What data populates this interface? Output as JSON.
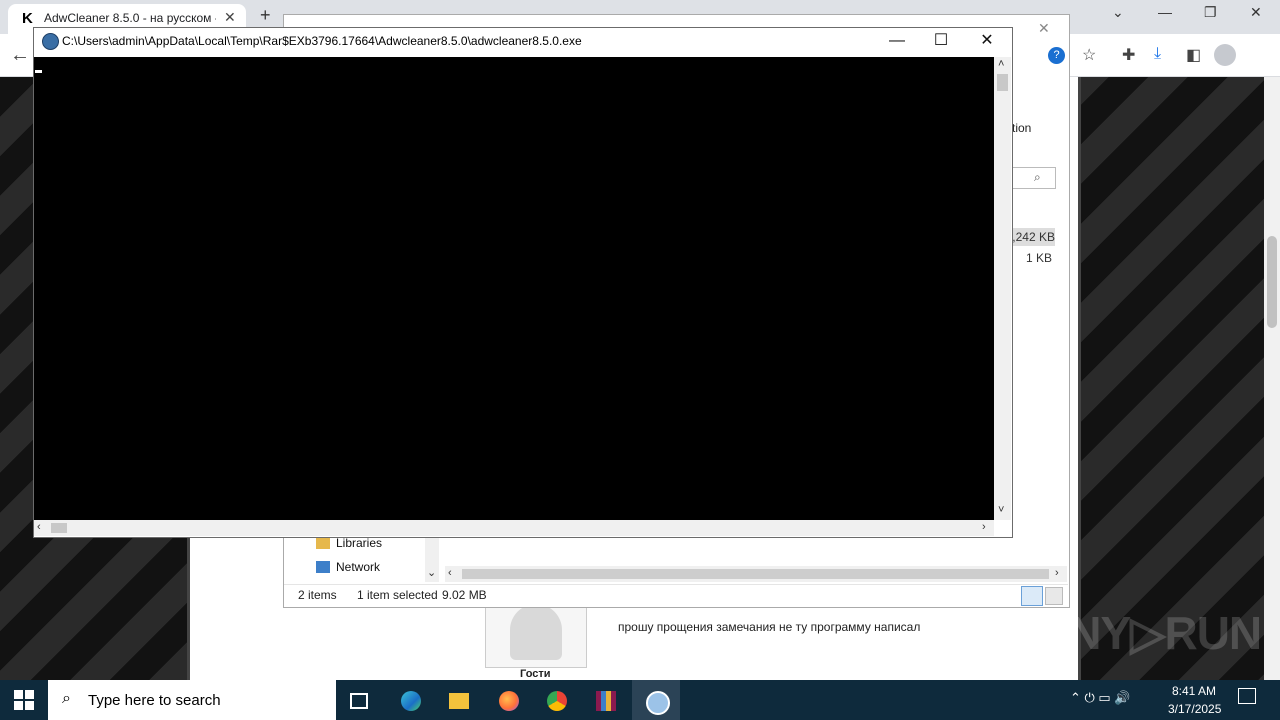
{
  "browser": {
    "tab_title": "AdwCleaner 8.5.0 - на русском -",
    "tab_favicon": "K",
    "close_glyph": "✕",
    "new_tab_glyph": "+",
    "toolbar_icons": [
      "back-arrow-icon",
      "help-icon",
      "star-icon",
      "extensions-icon",
      "download-icon",
      "sidebar-icon",
      "profile-icon"
    ]
  },
  "page": {
    "avatar_caption": "Гости",
    "comment_text": "прошу прощения замечания не ту программу написал",
    "watermark": "ANY▷RUN"
  },
  "explorer": {
    "ribbon_hint": "tion",
    "size_1": ",242 KB",
    "size_2": "1 KB",
    "nav": {
      "libraries": "Libraries",
      "network": "Network"
    },
    "status": {
      "items": "2 items",
      "selected": "1 item selected",
      "size": "9.02 MB"
    }
  },
  "console": {
    "title": "C:\\Users\\admin\\AppData\\Local\\Temp\\Rar$EXb3796.17664\\Adwcleaner8.5.0\\adwcleaner8.5.0.exe",
    "minimize": "—",
    "maximize": "☐",
    "close": "✕"
  },
  "taskbar": {
    "search_placeholder": "Type here to search",
    "apps": [
      "task-view-icon",
      "edge-icon",
      "file-explorer-icon",
      "firefox-icon",
      "chrome-icon",
      "winrar-icon",
      "adwcleaner-icon"
    ],
    "tray": "⌃  ⏻  ▭  🔊",
    "time": "8:41 AM",
    "date": "3/17/2025"
  }
}
